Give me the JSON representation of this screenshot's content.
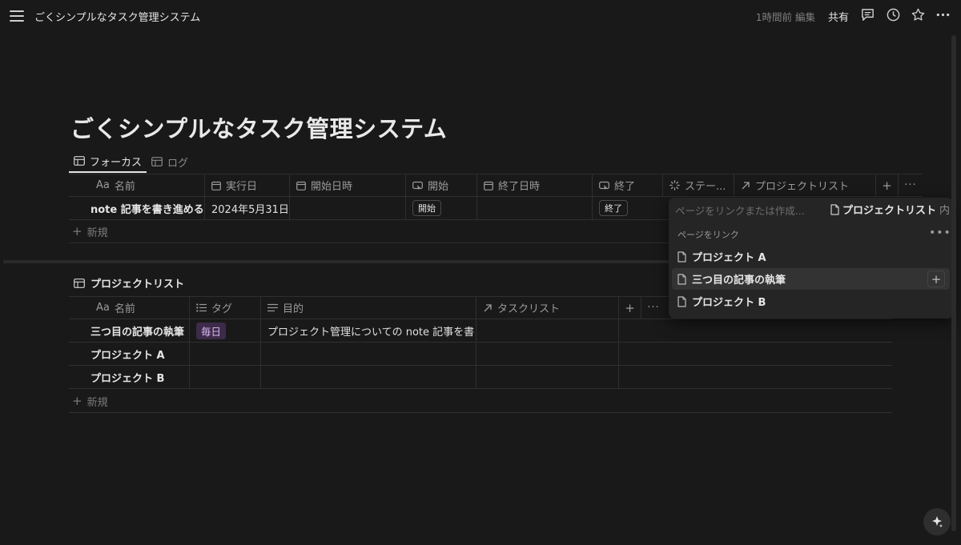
{
  "topbar": {
    "breadcrumb": "ごくシンプルなタスク管理システム",
    "edited": "1時間前 編集",
    "share": "共有"
  },
  "page": {
    "title": "ごくシンプルなタスク管理システム"
  },
  "view_tabs": [
    {
      "label": "フォーカス",
      "active": true
    },
    {
      "label": "ログ",
      "active": false
    }
  ],
  "focus_table": {
    "columns": [
      "名前",
      "実行日",
      "開始日時",
      "開始",
      "終了日時",
      "終了",
      "ステー...",
      "プロジェクトリスト"
    ],
    "name_prefix": "Aa",
    "rows": [
      {
        "name": "note 記事を書き進める",
        "date": "2024年5月31日",
        "start_dt": "",
        "start_btn": "開始",
        "end_dt": "",
        "end_btn": "終了"
      }
    ],
    "new_label": "新規"
  },
  "project_db": {
    "title": "プロジェクトリスト",
    "columns": [
      "名前",
      "タグ",
      "目的",
      "タスクリスト"
    ],
    "name_prefix": "Aa",
    "rows": [
      {
        "name": "三つ目の記事の執筆",
        "tag": "毎日",
        "purpose": "プロジェクト管理についての note 記事を書く",
        "tasks": ""
      },
      {
        "name": "プロジェクト A",
        "tag": "",
        "purpose": "",
        "tasks": ""
      },
      {
        "name": "プロジェクト B",
        "tag": "",
        "purpose": "",
        "tasks": ""
      }
    ],
    "new_label": "新規"
  },
  "popup": {
    "placeholder": "ページをリンクまたは作成...",
    "target": "プロジェクトリスト",
    "target_suffix": "内",
    "section": "ページをリンク",
    "items": [
      "プロジェクト A",
      "三つ目の記事の執筆",
      "プロジェクト B"
    ]
  },
  "colors": {
    "background": "#191919",
    "tag_bg": "#3d2b4a",
    "tag_text": "#d9b8ee"
  }
}
